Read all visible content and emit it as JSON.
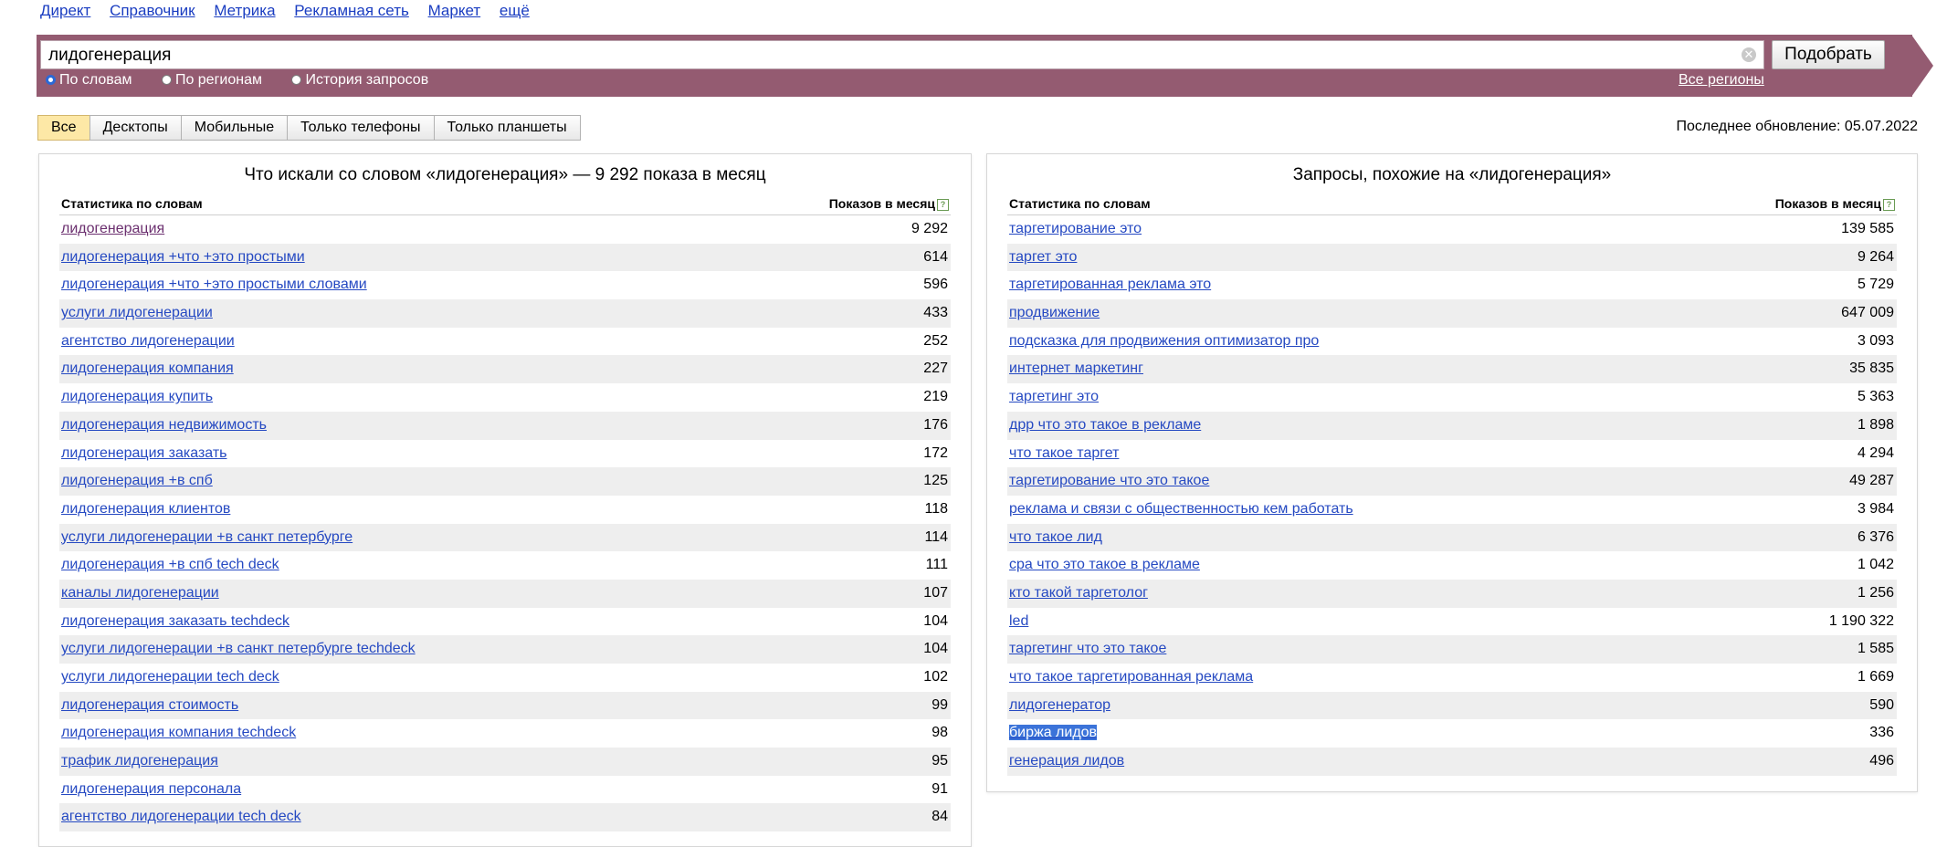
{
  "topnav": [
    "Директ",
    "Справочник",
    "Метрика",
    "Рекламная сеть",
    "Маркет",
    "ещё"
  ],
  "search": {
    "value": "лидогенерация",
    "button_label": "Подобрать",
    "clear_icon": "close-icon",
    "modes": [
      {
        "label": "По словам",
        "selected": true
      },
      {
        "label": "По регионам",
        "selected": false
      },
      {
        "label": "История запросов",
        "selected": false
      }
    ],
    "all_regions_label": "Все регионы"
  },
  "device_tabs": [
    {
      "label": "Все",
      "active": true
    },
    {
      "label": "Десктопы",
      "active": false
    },
    {
      "label": "Мобильные",
      "active": false
    },
    {
      "label": "Только телефоны",
      "active": false
    },
    {
      "label": "Только планшеты",
      "active": false
    }
  ],
  "last_update": "Последнее обновление: 05.07.2022",
  "left_panel": {
    "title": "Что искали со словом «лидогенерация» — 9 292 показа в месяц",
    "col_phrase": "Статистика по словам",
    "col_count": "Показов в месяц",
    "rows": [
      {
        "phrase": "лидогенерация",
        "count": "9 292",
        "visited": true
      },
      {
        "phrase": "лидогенерация +что +это простыми",
        "count": "614"
      },
      {
        "phrase": "лидогенерация +что +это простыми словами",
        "count": "596"
      },
      {
        "phrase": "услуги лидогенерации",
        "count": "433"
      },
      {
        "phrase": "агентство лидогенерации",
        "count": "252"
      },
      {
        "phrase": "лидогенерация компания",
        "count": "227"
      },
      {
        "phrase": "лидогенерация купить",
        "count": "219"
      },
      {
        "phrase": "лидогенерация недвижимость",
        "count": "176"
      },
      {
        "phrase": "лидогенерация заказать",
        "count": "172"
      },
      {
        "phrase": "лидогенерация +в спб",
        "count": "125"
      },
      {
        "phrase": "лидогенерация клиентов",
        "count": "118"
      },
      {
        "phrase": "услуги лидогенерации +в санкт петербурге",
        "count": "114"
      },
      {
        "phrase": "лидогенерация +в спб tech deck",
        "count": "111"
      },
      {
        "phrase": "каналы лидогенерации",
        "count": "107"
      },
      {
        "phrase": "лидогенерация заказать techdeck",
        "count": "104"
      },
      {
        "phrase": "услуги лидогенерации +в санкт петербурге techdeck",
        "count": "104"
      },
      {
        "phrase": "услуги лидогенерации tech deck",
        "count": "102"
      },
      {
        "phrase": "лидогенерация стоимость",
        "count": "99"
      },
      {
        "phrase": "лидогенерация компания techdeck",
        "count": "98"
      },
      {
        "phrase": "трафик лидогенерация",
        "count": "95"
      },
      {
        "phrase": "лидогенерация персонала",
        "count": "91"
      },
      {
        "phrase": "агентство лидогенерации tech deck",
        "count": "84"
      }
    ]
  },
  "right_panel": {
    "title": "Запросы, похожие на «лидогенерация»",
    "col_phrase": "Статистика по словам",
    "col_count": "Показов в месяц",
    "rows": [
      {
        "phrase": "таргетирование это",
        "count": "139 585"
      },
      {
        "phrase": "таргет это",
        "count": "9 264"
      },
      {
        "phrase": "таргетированная реклама это",
        "count": "5 729"
      },
      {
        "phrase": "продвижение",
        "count": "647 009"
      },
      {
        "phrase": "подсказка для продвижения оптимизатор про",
        "count": "3 093"
      },
      {
        "phrase": "интернет маркетинг",
        "count": "35 835"
      },
      {
        "phrase": "таргетинг это",
        "count": "5 363"
      },
      {
        "phrase": "дрр что это такое в рекламе",
        "count": "1 898"
      },
      {
        "phrase": "что такое таргет",
        "count": "4 294"
      },
      {
        "phrase": "таргетирование что это такое",
        "count": "49 287"
      },
      {
        "phrase": "реклама и связи с общественностью кем работать",
        "count": "3 984"
      },
      {
        "phrase": "что такое лид",
        "count": "6 376"
      },
      {
        "phrase": "cpa что это такое в рекламе",
        "count": "1 042"
      },
      {
        "phrase": "кто такой таргетолог",
        "count": "1 256"
      },
      {
        "phrase": "led",
        "count": "1 190 322"
      },
      {
        "phrase": "таргетинг что это такое",
        "count": "1 585"
      },
      {
        "phrase": "что такое таргетированная реклама",
        "count": "1 669"
      },
      {
        "phrase": "лидогенератор",
        "count": "590"
      },
      {
        "phrase": "биржа лидов",
        "count": "336",
        "highlighted": true
      },
      {
        "phrase": "генерация лидов",
        "count": "496"
      }
    ]
  }
}
